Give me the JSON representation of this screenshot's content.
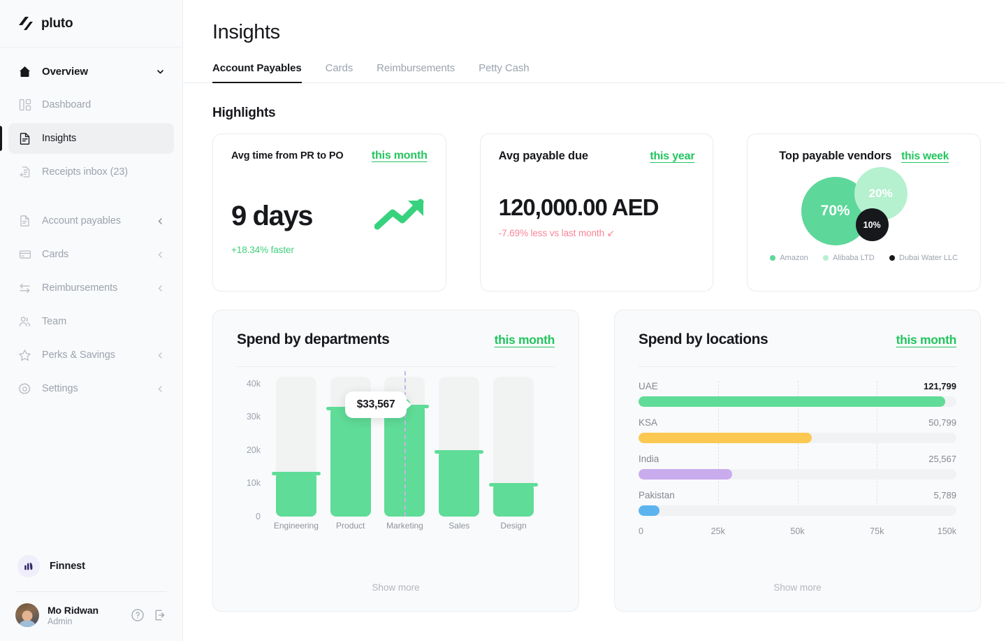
{
  "brand": {
    "name": "pluto",
    "logo_icon": "pluto-logo-icon"
  },
  "sidebar": {
    "overview": {
      "label": "Overview",
      "icon": "home-icon",
      "chevron": "chevron-down-icon"
    },
    "items": [
      {
        "label": "Dashboard",
        "icon": "dashboard-icon",
        "active": false,
        "chevron": ""
      },
      {
        "label": "Insights",
        "icon": "insights-document-icon",
        "active": true,
        "chevron": ""
      },
      {
        "label": "Receipts inbox (23)",
        "icon": "receipts-inbox-icon",
        "active": false,
        "chevron": ""
      }
    ],
    "items2": [
      {
        "label": "Account payables",
        "icon": "document-icon",
        "chevron": "chevron-left-icon"
      },
      {
        "label": "Cards",
        "icon": "card-icon",
        "chevron": "chevron-left-icon"
      },
      {
        "label": "Reimbursements",
        "icon": "reimbursements-icon",
        "chevron": "chevron-left-icon"
      },
      {
        "label": "Team",
        "icon": "team-icon",
        "chevron": ""
      },
      {
        "label": "Perks & Savings",
        "icon": "star-icon",
        "chevron": "chevron-left-icon"
      },
      {
        "label": "Settings",
        "icon": "gear-icon",
        "chevron": "chevron-left-icon"
      }
    ],
    "org": {
      "name": "Finnest",
      "avatar_icon": "finnest-logo-icon"
    },
    "user": {
      "name": "Mo Ridwan",
      "role": "Admin",
      "avatar": "user-avatar",
      "help_icon": "help-circle-icon",
      "logout_icon": "logout-icon"
    }
  },
  "header": {
    "title": "Insights",
    "tabs": [
      {
        "label": "Account Payables",
        "active": true
      },
      {
        "label": "Cards",
        "active": false
      },
      {
        "label": "Reimbursements",
        "active": false
      },
      {
        "label": "Petty Cash",
        "active": false
      }
    ]
  },
  "highlights": {
    "section_title": "Highlights",
    "cards": [
      {
        "title": "Avg time from PR to PO",
        "period": "this month",
        "value": "9 days",
        "delta": "+18.34% faster",
        "delta_direction": "up",
        "icon": "trend-up-arrow-icon"
      },
      {
        "title": "Avg payable due",
        "period": "this year",
        "value": "120,000.00 AED",
        "delta": "-7.69% less vs last month ↙",
        "delta_direction": "down"
      }
    ],
    "vendors": {
      "title": "Top payable vendors",
      "period": "this week",
      "legend": [
        {
          "label": "Amazon",
          "color": "#5dd79a",
          "percent": "70%"
        },
        {
          "label": "Alibaba LTD",
          "color": "#b5f0cf",
          "percent": "20%"
        },
        {
          "label": "Dubai Water LLC",
          "color": "#17181c",
          "percent": "10%"
        }
      ]
    }
  },
  "departments_panel": {
    "title": "Spend by departments",
    "period": "this month",
    "show_more": "Show more",
    "tooltip": "$33,567"
  },
  "locations_panel": {
    "title": "Spend by locations",
    "period": "this month",
    "show_more": "Show more"
  },
  "chart_data": [
    {
      "type": "bar",
      "title": "Spend by departments",
      "categories": [
        "Engineering",
        "Product",
        "Marketing",
        "Sales",
        "Design"
      ],
      "values": [
        13500,
        33000,
        33567,
        20000,
        10000
      ],
      "value_labels": [
        "",
        "",
        "$33,567",
        "",
        ""
      ],
      "ytick_labels": [
        "40k",
        "30k",
        "20k",
        "10k",
        "0"
      ],
      "yticks": [
        40000,
        30000,
        20000,
        10000,
        0
      ],
      "ylim": [
        0,
        42000
      ],
      "xlabel": "",
      "ylabel": "",
      "grid": false,
      "bar_color": "#5fdc97",
      "track_color": "#f1f2f2",
      "highlight_index": 2,
      "highlight_value": "$33,567",
      "legend_position": "none"
    },
    {
      "type": "bar",
      "title": "Spend by locations",
      "orientation": "horizontal",
      "categories": [
        "UAE",
        "KSA",
        "India",
        "Pakistan"
      ],
      "values": [
        121799,
        50799,
        25567,
        5789
      ],
      "value_labels": [
        "121,799",
        "50,799",
        "25,567",
        "5,789"
      ],
      "colors": [
        "#5fdc97",
        "#fbc852",
        "#c9aced",
        "#5cb4ee"
      ],
      "xtick_labels": [
        "0",
        "25k",
        "50k",
        "75k",
        "150k"
      ],
      "xlim": [
        0,
        150000
      ],
      "grid": true,
      "legend_position": "none"
    }
  ]
}
